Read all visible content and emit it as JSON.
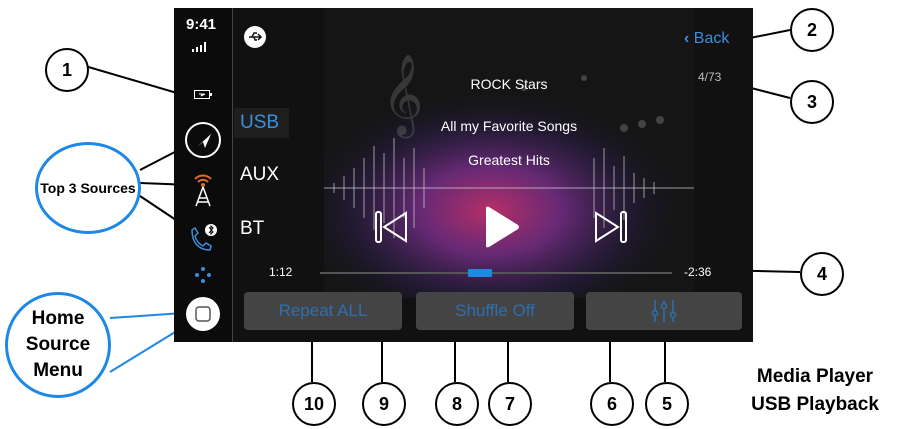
{
  "status": {
    "time": "9:41"
  },
  "back_label": "Back",
  "track_count": "4/73",
  "sources": [
    "USB",
    "AUX",
    "BT"
  ],
  "tracks": [
    "ROCK Stars",
    "All my Favorite Songs",
    "Greatest Hits"
  ],
  "elapsed": "1:12",
  "remaining": "-2:36",
  "progress_fraction": 0.45,
  "buttons": {
    "repeat": "Repeat ALL",
    "shuffle": "Shuffle Off"
  },
  "annotations": {
    "top3": "Top 3 Sources",
    "home": "Home Source Menu",
    "caption_line1": "Media Player",
    "caption_line2": "USB Playback",
    "numbers": [
      "1",
      "2",
      "3",
      "4",
      "5",
      "6",
      "7",
      "8",
      "9",
      "10"
    ]
  },
  "colors": {
    "accent": "#1e88e5",
    "background": "#111111"
  }
}
